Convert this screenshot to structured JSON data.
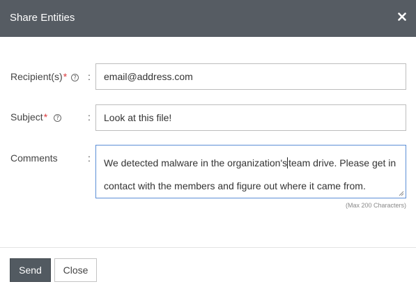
{
  "dialog": {
    "title": "Share Entities",
    "close_icon": "close-icon"
  },
  "form": {
    "recipients": {
      "label": "Recipient(s)",
      "required_marker": "*",
      "help_glyph": "?",
      "colon": ":",
      "value": "email@address.com"
    },
    "subject": {
      "label": "Subject",
      "required_marker": "*",
      "help_glyph": "?",
      "colon": ":",
      "value": "Look at this file!"
    },
    "comments": {
      "label": "Comments",
      "colon": ":",
      "value_before_caret": "We detected malware in the organization's",
      "value_after_caret": "team drive.  Please get in contact with the members and figure out where it came from.",
      "max_note": "(Max 200 Characters)"
    }
  },
  "buttons": {
    "send": "Send",
    "close": "Close"
  },
  "colors": {
    "header_bg": "#565c63",
    "required": "#d9373b",
    "focus_border": "#5b8ed6",
    "send_bg": "#525a61"
  }
}
